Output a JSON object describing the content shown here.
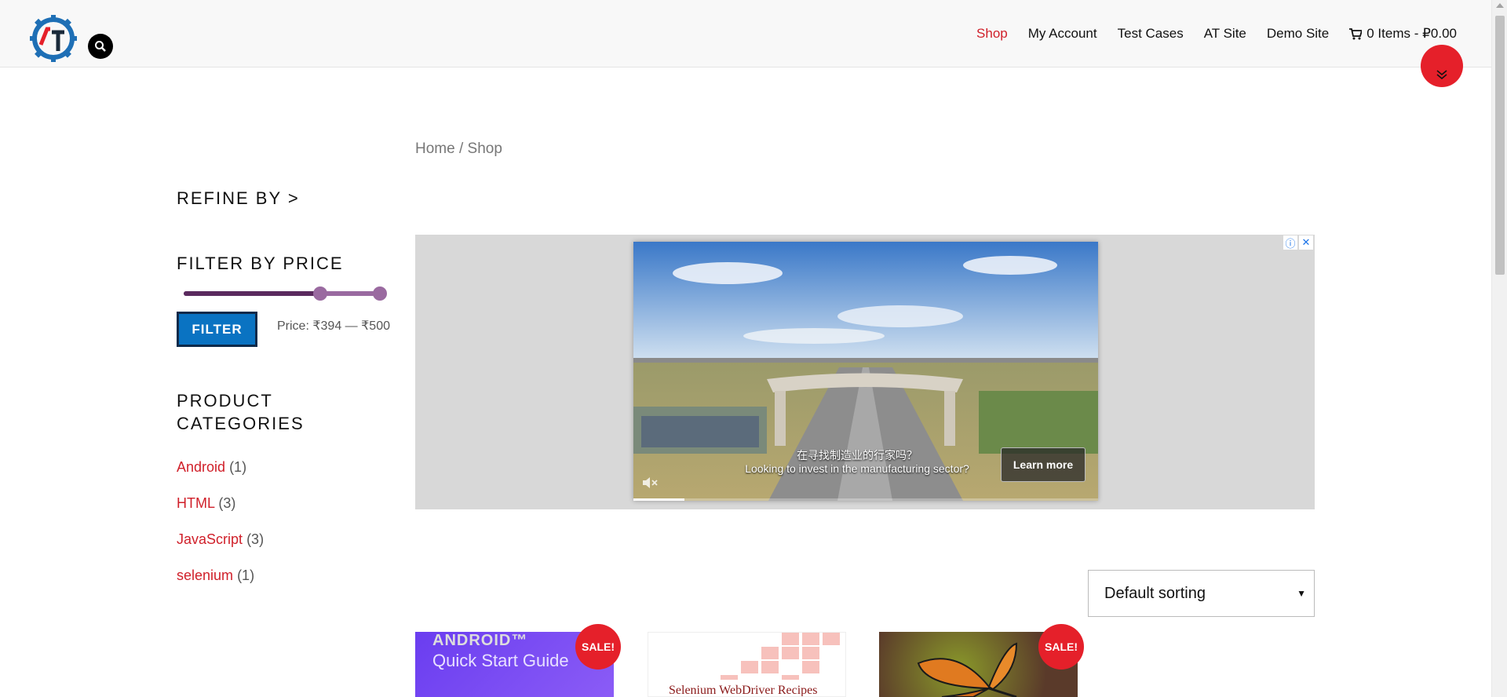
{
  "nav": {
    "items": [
      {
        "label": "Shop",
        "active": true
      },
      {
        "label": "My Account"
      },
      {
        "label": "Test Cases"
      },
      {
        "label": "AT Site"
      },
      {
        "label": "Demo Site"
      }
    ],
    "cart_label": "0 Items - ₽0.00"
  },
  "breadcrumb": {
    "home": "Home",
    "sep": " / ",
    "current": "Shop"
  },
  "sidebar": {
    "refine_title": "REFINE BY >",
    "price_title": "FILTER BY PRICE",
    "filter_button": "FILTER",
    "price_range": "Price: ₹394 — ₹500",
    "categories_title": "PRODUCT CATEGORIES",
    "categories": [
      {
        "name": "Android",
        "count": "(1)"
      },
      {
        "name": "HTML",
        "count": "(3)"
      },
      {
        "name": "JavaScript",
        "count": "(3)"
      },
      {
        "name": "selenium",
        "count": "(1)"
      }
    ]
  },
  "ad": {
    "caption_cn": "在寻找制造业的行家吗？",
    "caption_en": "Looking to invest in the manufacturing sector?",
    "learn_more": "Learn more",
    "progress": 0.11
  },
  "sort": {
    "selected": "Default sorting"
  },
  "products": [
    {
      "line1": "ANDROID™",
      "line2": "Quick Start Guide",
      "sale": "SALE!"
    },
    {
      "line1": "Selenium WebDriver Recipes"
    },
    {
      "sale": "SALE!"
    }
  ],
  "colors": {
    "accent": "#d0202a",
    "button": "#0a73c2",
    "slider": "#5a2a5e"
  }
}
